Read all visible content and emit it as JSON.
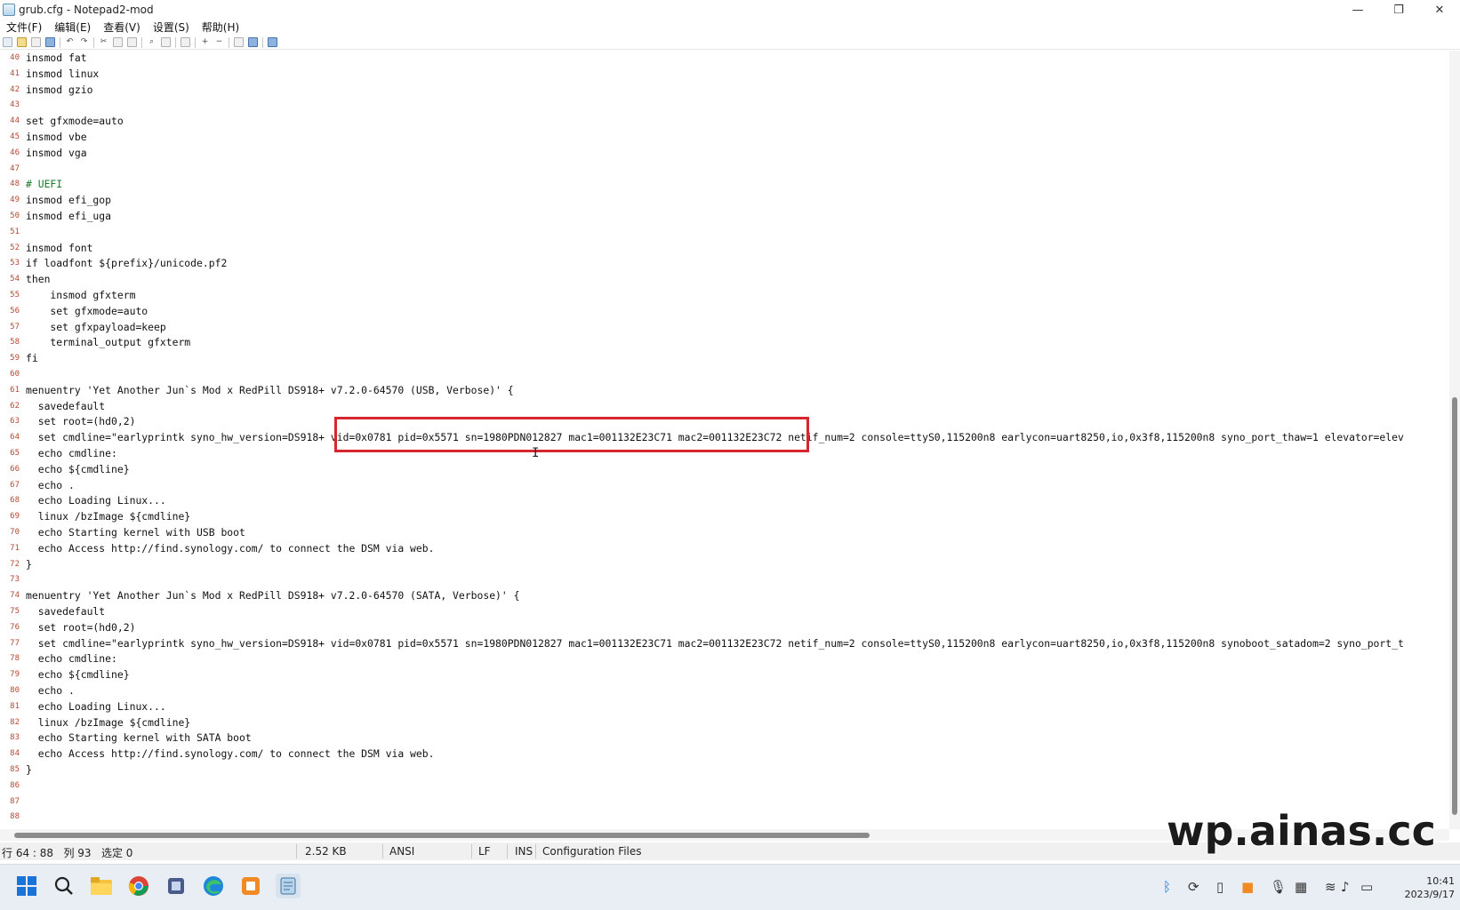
{
  "window": {
    "title": "grub.cfg - Notepad2-mod",
    "minimize": "—",
    "maximize": "❐",
    "close": "✕"
  },
  "menu": [
    "文件(F)",
    "编辑(E)",
    "查看(V)",
    "设置(S)",
    "帮助(H)"
  ],
  "editor": {
    "lines": [
      {
        "n": "40",
        "t": "insmod fat"
      },
      {
        "n": "41",
        "t": "insmod linux"
      },
      {
        "n": "42",
        "t": "insmod gzio"
      },
      {
        "n": "43",
        "t": ""
      },
      {
        "n": "44",
        "t": "set gfxmode=auto"
      },
      {
        "n": "45",
        "t": "insmod vbe"
      },
      {
        "n": "46",
        "t": "insmod vga"
      },
      {
        "n": "47",
        "t": ""
      },
      {
        "n": "48",
        "t": "# UEFI",
        "comment": true
      },
      {
        "n": "49",
        "t": "insmod efi_gop"
      },
      {
        "n": "50",
        "t": "insmod efi_uga"
      },
      {
        "n": "51",
        "t": ""
      },
      {
        "n": "52",
        "t": "insmod font"
      },
      {
        "n": "53",
        "t": "if loadfont ${prefix}/unicode.pf2"
      },
      {
        "n": "54",
        "t": "then"
      },
      {
        "n": "55",
        "t": "    insmod gfxterm"
      },
      {
        "n": "56",
        "t": "    set gfxmode=auto"
      },
      {
        "n": "57",
        "t": "    set gfxpayload=keep"
      },
      {
        "n": "58",
        "t": "    terminal_output gfxterm"
      },
      {
        "n": "59",
        "t": "fi"
      },
      {
        "n": "60",
        "t": ""
      },
      {
        "n": "61",
        "t": "menuentry 'Yet Another Jun`s Mod x RedPill DS918+ v7.2.0-64570 (USB, Verbose)' {"
      },
      {
        "n": "62",
        "t": "  savedefault"
      },
      {
        "n": "63",
        "t": "  set root=(hd0,2)"
      },
      {
        "n": "64",
        "t": "  set cmdline=\"earlyprintk syno_hw_version=DS918+ vid=0x0781 pid=0x5571 sn=1980PDN012827 mac1=001132E23C71 mac2=001132E23C72 netif_num=2 console=ttyS0,115200n8 earlycon=uart8250,io,0x3f8,115200n8 syno_port_thaw=1 elevator=elev"
      },
      {
        "n": "65",
        "t": "  echo cmdline:"
      },
      {
        "n": "66",
        "t": "  echo ${cmdline}"
      },
      {
        "n": "67",
        "t": "  echo ."
      },
      {
        "n": "68",
        "t": "  echo Loading Linux..."
      },
      {
        "n": "69",
        "t": "  linux /bzImage ${cmdline}"
      },
      {
        "n": "70",
        "t": "  echo Starting kernel with USB boot"
      },
      {
        "n": "71",
        "t": "  echo Access http://find.synology.com/ to connect the DSM via web."
      },
      {
        "n": "72",
        "t": "}"
      },
      {
        "n": "73",
        "t": ""
      },
      {
        "n": "74",
        "t": "menuentry 'Yet Another Jun`s Mod x RedPill DS918+ v7.2.0-64570 (SATA, Verbose)' {"
      },
      {
        "n": "75",
        "t": "  savedefault"
      },
      {
        "n": "76",
        "t": "  set root=(hd0,2)"
      },
      {
        "n": "77",
        "t": "  set cmdline=\"earlyprintk syno_hw_version=DS918+ vid=0x0781 pid=0x5571 sn=1980PDN012827 mac1=001132E23C71 mac2=001132E23C72 netif_num=2 console=ttyS0,115200n8 earlycon=uart8250,io,0x3f8,115200n8 synoboot_satadom=2 syno_port_t"
      },
      {
        "n": "78",
        "t": "  echo cmdline:"
      },
      {
        "n": "79",
        "t": "  echo ${cmdline}"
      },
      {
        "n": "80",
        "t": "  echo ."
      },
      {
        "n": "81",
        "t": "  echo Loading Linux..."
      },
      {
        "n": "82",
        "t": "  linux /bzImage ${cmdline}"
      },
      {
        "n": "83",
        "t": "  echo Starting kernel with SATA boot"
      },
      {
        "n": "84",
        "t": "  echo Access http://find.synology.com/ to connect the DSM via web."
      },
      {
        "n": "85",
        "t": "}"
      },
      {
        "n": "86",
        "t": ""
      },
      {
        "n": "87",
        "t": ""
      },
      {
        "n": "88",
        "t": ""
      }
    ]
  },
  "status": {
    "position": "行 64 : 88   列 93   选定 0",
    "size": "2.52 KB",
    "encoding": "ANSI",
    "eol": "LF",
    "mode": "INS",
    "scheme": "Configuration Files"
  },
  "watermark": "wp.ainas.cc",
  "clock": {
    "time": "10:41",
    "date": "2023/9/17"
  },
  "colors": {
    "highlight": "#d8262e",
    "line_numbers": "#b34a32",
    "comment": "#1a7a2a"
  },
  "taskbar_icons": [
    "windows-start-icon",
    "search-icon",
    "file-explorer-icon",
    "chrome-icon",
    "app-icon",
    "edge-icon",
    "app-orange-icon",
    "notepad-icon"
  ],
  "tray_icons": [
    "bluetooth-icon",
    "sync-icon",
    "usb-icon",
    "app-tray-icon",
    "microphone-icon",
    "input-method-icon",
    "wifi-icon",
    "volume-icon",
    "battery-icon"
  ]
}
